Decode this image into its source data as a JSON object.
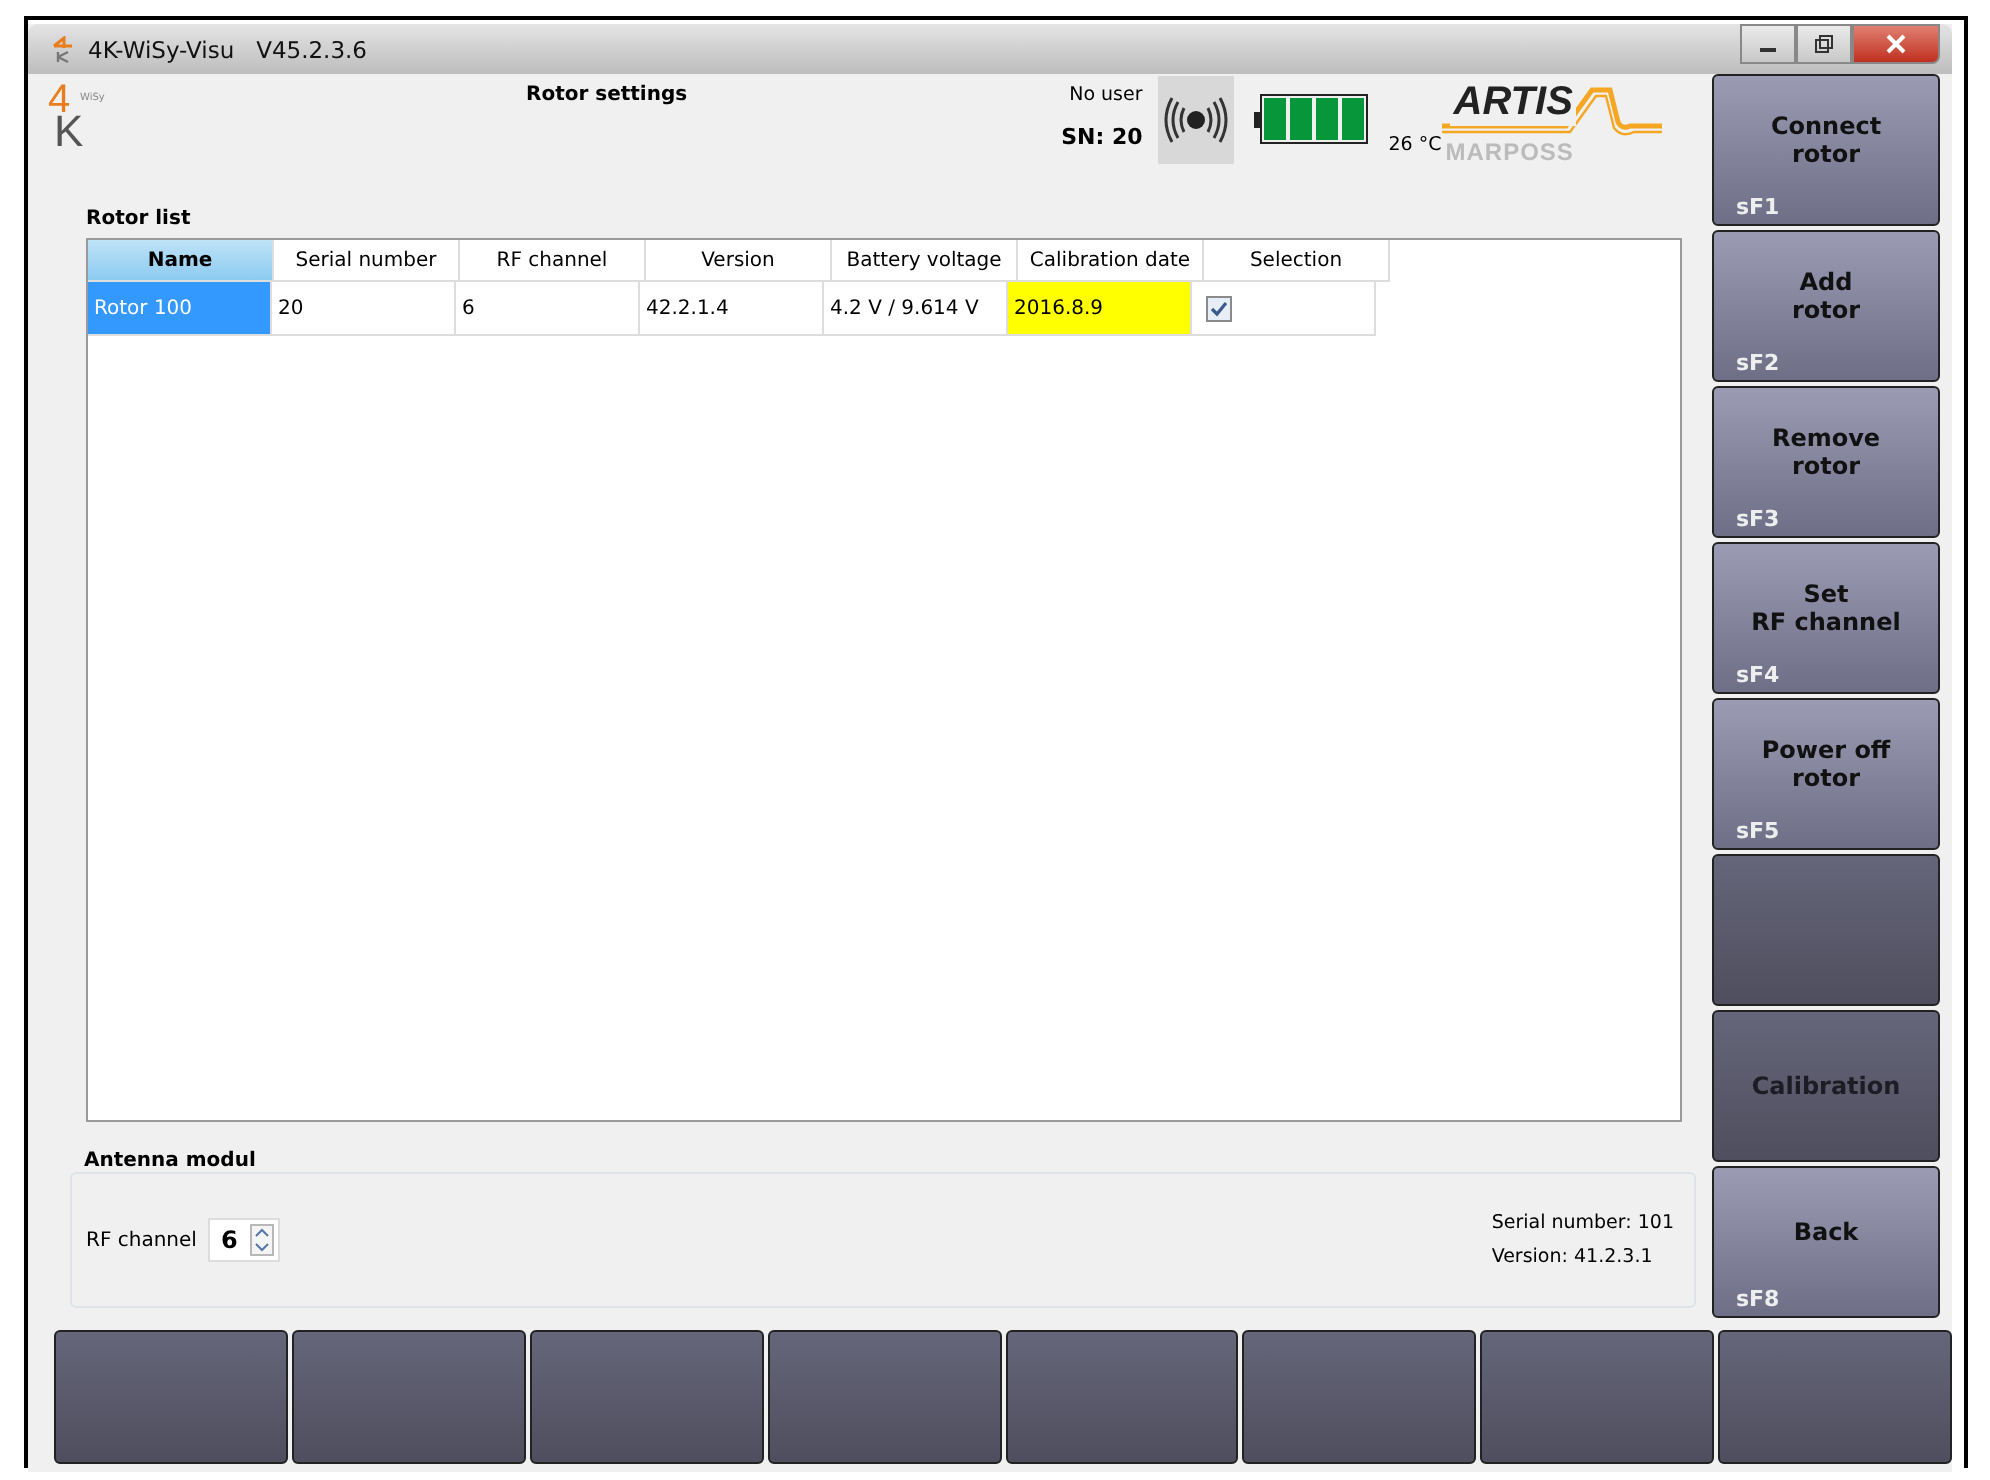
{
  "window": {
    "title": "4K-WiSy-Visu   V45.2.3.6"
  },
  "logo": {
    "digit": "4",
    "letter": "K",
    "sub": "WiSy"
  },
  "page_title": "Rotor settings",
  "status": {
    "user": "No user",
    "sn": "SN: 20",
    "temperature": "26 °C"
  },
  "brand": {
    "top": "ARTIS",
    "bottom": "MARPOSS"
  },
  "rotor_list": {
    "title": "Rotor list",
    "columns": [
      {
        "label": "Name",
        "selected": true
      },
      {
        "label": "Serial number",
        "selected": false
      },
      {
        "label": "RF channel",
        "selected": false
      },
      {
        "label": "Version",
        "selected": false
      },
      {
        "label": "Battery voltage",
        "selected": false
      },
      {
        "label": "Calibration date",
        "selected": false
      },
      {
        "label": "Selection",
        "selected": false
      }
    ],
    "rows": [
      {
        "selected": true,
        "name": "Rotor 100",
        "serial_number": "20",
        "rf_channel": "6",
        "version": "42.2.1.4",
        "battery_voltage": "4.2 V / 9.614 V",
        "calibration_date": "2016.8.9",
        "calibration_warning": true,
        "checked": true
      }
    ]
  },
  "antenna": {
    "title": "Antenna modul",
    "rf_label": "RF channel",
    "rf_value": "6",
    "serial": "Serial number: 101",
    "version": "Version: 41.2.3.1"
  },
  "side_buttons": [
    {
      "label": "Connect\nrotor",
      "key": "sF1",
      "disabled": false
    },
    {
      "label": "Add\nrotor",
      "key": "sF2",
      "disabled": false
    },
    {
      "label": "Remove\nrotor",
      "key": "sF3",
      "disabled": false
    },
    {
      "label": "Set\nRF channel",
      "key": "sF4",
      "disabled": false
    },
    {
      "label": "Power off\nrotor",
      "key": "sF5",
      "disabled": false
    },
    {
      "disabled": true
    },
    {
      "label": "Calibration",
      "disabled": true
    },
    {
      "label": "Back",
      "key": "sF8",
      "disabled": false
    }
  ],
  "bottom_buttons": [
    {
      "disabled": true
    },
    {
      "disabled": true
    },
    {
      "disabled": true
    },
    {
      "disabled": true
    },
    {
      "disabled": true
    },
    {
      "disabled": true
    },
    {
      "disabled": true
    },
    {
      "disabled": true
    }
  ]
}
